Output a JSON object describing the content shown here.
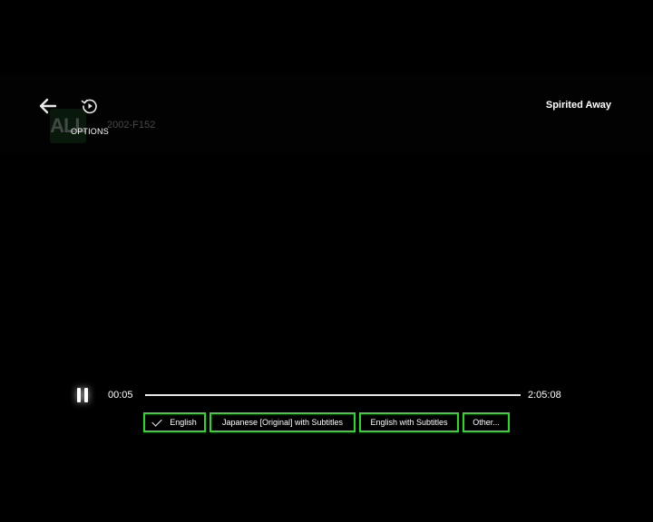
{
  "header": {
    "title": "Spirited Away",
    "options_label": "OPTIONS",
    "back_icon": "arrow-left-icon",
    "replay_icon": "replay-icon"
  },
  "watermark": {
    "logo_text": "ALL",
    "code": "2002-F152"
  },
  "playback": {
    "state_icon": "pause-icon",
    "current_time": "00:05",
    "total_time": "2:05:08",
    "progress": 0.0007
  },
  "audio_options": [
    {
      "label": "English",
      "selected": true
    },
    {
      "label": "Japanese [Original] with Subtitles",
      "selected": false
    },
    {
      "label": "English with Subtitles",
      "selected": false
    },
    {
      "label": "Other...",
      "selected": false
    }
  ],
  "colors": {
    "focus_outline": "#22e01c",
    "background": "#000000",
    "text": "#ffffff"
  }
}
